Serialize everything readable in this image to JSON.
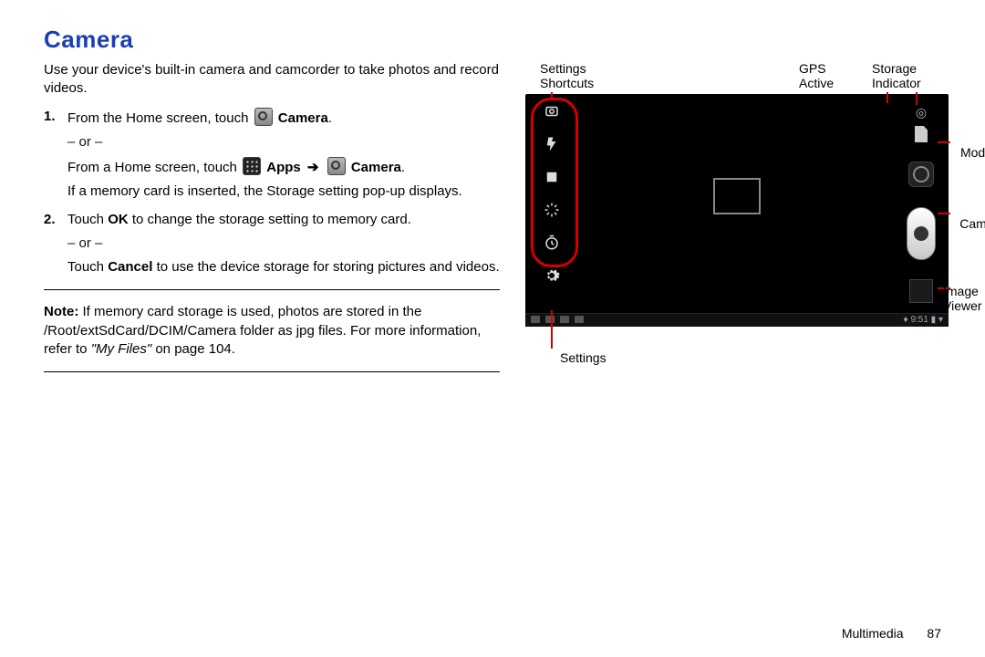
{
  "title": "Camera",
  "intro": "Use your device's built-in camera and camcorder to take photos and record videos.",
  "steps": {
    "s1": {
      "num": "1.",
      "pre": "From the Home screen, touch ",
      "camera_bold": "Camera",
      "period": ".",
      "or": "– or –",
      "alt_pre": "From a Home screen, touch ",
      "apps_bold": "Apps",
      "arrow": "➔",
      "alt_camera_bold": "Camera",
      "alt_period": ".",
      "alt_tail": "If a memory card is inserted, the Storage setting pop-up displays."
    },
    "s2": {
      "num": "2.",
      "pre": "Touch ",
      "ok_bold": "OK",
      "post": " to change the storage setting to memory card.",
      "or": "– or –",
      "cancel_pre": "Touch ",
      "cancel_bold": "Cancel",
      "cancel_post": " to use the device storage for storing pictures and videos."
    }
  },
  "note": {
    "label": "Note:",
    "body_pre": " If memory card storage is used, photos are stored in the /Root/extSdCard/DCIM/Camera folder as jpg files. For more information, refer to ",
    "ref": "\"My Files\"",
    "body_post": "  on page 104."
  },
  "labels": {
    "settings_shortcuts": "Settings Shortcuts",
    "gps_active": "GPS Active",
    "storage_indicator": "Storage Indicator",
    "mode": "Mode",
    "camera": "Camera",
    "image_viewer": "Image Viewer",
    "settings": "Settings"
  },
  "status_time": "9:51",
  "footer": {
    "section": "Multimedia",
    "page": "87"
  }
}
